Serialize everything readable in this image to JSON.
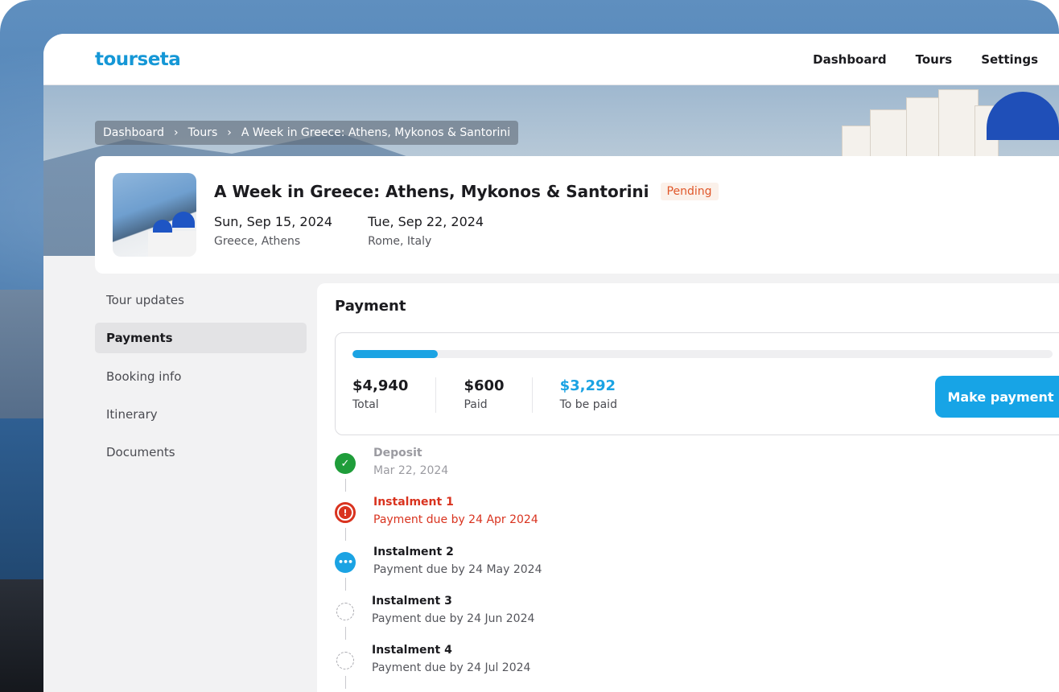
{
  "brand": {
    "name": "tourseta"
  },
  "nav": {
    "items": [
      "Dashboard",
      "Tours",
      "Settings"
    ]
  },
  "breadcrumb": [
    "Dashboard",
    "Tours",
    "A Week in Greece: Athens, Mykonos & Santorini"
  ],
  "tour": {
    "title": "A Week in Greece: Athens, Mykonos & Santorini",
    "status": "Pending",
    "start": {
      "date": "Sun, Sep 15, 2024",
      "location": "Greece, Athens"
    },
    "end": {
      "date": "Tue, Sep 22, 2024",
      "location": "Rome, Italy"
    }
  },
  "sidebar": {
    "items": [
      "Tour updates",
      "Payments",
      "Booking info",
      "Itinerary",
      "Documents"
    ],
    "active": "Payments"
  },
  "payment": {
    "title": "Payment",
    "progress_fraction": 0.1214,
    "total": {
      "value": "$4,940",
      "label": "Total"
    },
    "paid": {
      "value": "$600",
      "label": "Paid"
    },
    "due": {
      "value": "$3,292",
      "label": "To be paid"
    },
    "button_label": "Make payment",
    "schedule": [
      {
        "name": "Deposit",
        "detail": "Mar 22, 2024",
        "state": "done",
        "icon": "check-icon"
      },
      {
        "name": "Instalment 1",
        "detail": "Payment due by 24 Apr 2024",
        "state": "overdue",
        "icon": "alert-icon"
      },
      {
        "name": "Instalment 2",
        "detail": "Payment due by 24 May 2024",
        "state": "current",
        "icon": "ellipsis-icon"
      },
      {
        "name": "Instalment 3",
        "detail": "Payment due by 24 Jun 2024",
        "state": "future",
        "icon": "dashed-circle-icon"
      },
      {
        "name": "Instalment 4",
        "detail": "Payment due by 24 Jul 2024",
        "state": "future",
        "icon": "dashed-circle-icon"
      }
    ]
  },
  "colors": {
    "brand": "#1597d6",
    "accent": "#1ba3e3",
    "success": "#1f9d3a",
    "danger": "#d9331f",
    "pending": "#e0572a"
  }
}
